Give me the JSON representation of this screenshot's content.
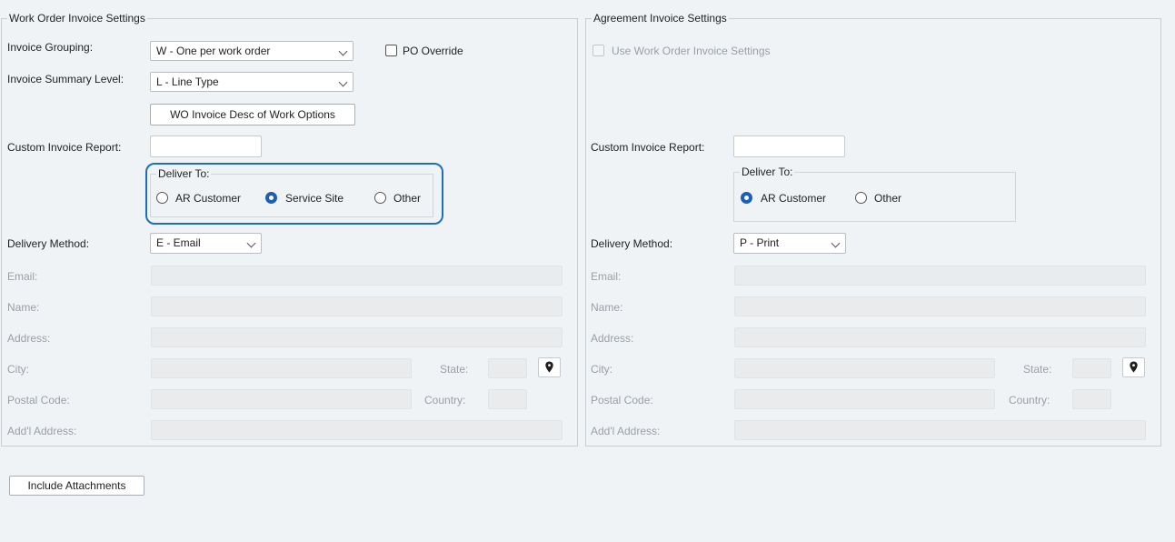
{
  "work_order": {
    "legend": "Work Order Invoice Settings",
    "invoice_grouping_label": "Invoice Grouping:",
    "invoice_grouping_value": "W - One per work order",
    "po_override_label": "PO Override",
    "summary_level_label": "Invoice Summary Level:",
    "summary_level_value": "L - Line Type",
    "desc_options_button": "WO Invoice Desc of Work Options",
    "custom_report_label": "Custom Invoice Report:",
    "deliver_to": {
      "legend": "Deliver To:",
      "options": [
        "AR Customer",
        "Service Site",
        "Other"
      ],
      "selected": "Service Site"
    },
    "delivery_method_label": "Delivery Method:",
    "delivery_method_value": "E - Email",
    "email_label": "Email:",
    "name_label": "Name:",
    "address_label": "Address:",
    "city_label": "City:",
    "state_label": "State:",
    "postal_label": "Postal Code:",
    "country_label": "Country:",
    "addl_address_label": "Add'l Address:"
  },
  "agreement": {
    "legend": "Agreement Invoice Settings",
    "use_wo_settings_label": "Use Work Order Invoice Settings",
    "custom_report_label": "Custom Invoice Report:",
    "deliver_to": {
      "legend": "Deliver To:",
      "options": [
        "AR Customer",
        "Other"
      ],
      "selected": "AR Customer"
    },
    "delivery_method_label": "Delivery Method:",
    "delivery_method_value": "P - Print",
    "email_label": "Email:",
    "name_label": "Name:",
    "address_label": "Address:",
    "city_label": "City:",
    "state_label": "State:",
    "postal_label": "Postal Code:",
    "country_label": "Country:",
    "addl_address_label": "Add'l Address:"
  },
  "include_attachments_button": "Include Attachments",
  "colors": {
    "accent": "#1a5fb4",
    "highlight": "#1f6fb8",
    "background": "#f0f3f6"
  },
  "icons": {
    "dropdown": "chevron-down-icon",
    "map": "map-pin-icon"
  }
}
